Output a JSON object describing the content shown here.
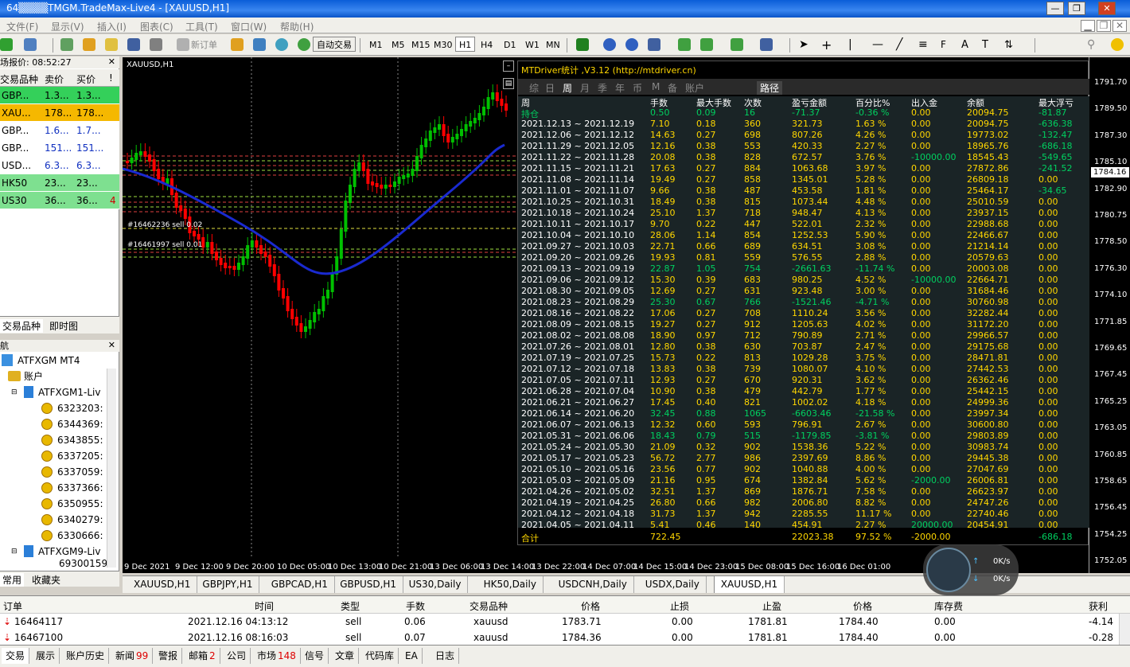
{
  "window": {
    "title": "64▒▒▒▒TMGM.TradeMax-Live4 - [XAUUSD,H1]",
    "buttons": [
      "—",
      "❐",
      "✕"
    ]
  },
  "menu": [
    "文件(F)",
    "显示(V)",
    "插入(I)",
    "图表(C)",
    "工具(T)",
    "窗口(W)",
    "帮助(H)"
  ],
  "toolbar": {
    "new_order": "新订单",
    "auto_trade": "自动交易",
    "timeframes": [
      "M1",
      "M5",
      "M15",
      "M30",
      "H1",
      "H4",
      "D1",
      "W1",
      "MN"
    ],
    "active_timeframe": "H1"
  },
  "market_watch": {
    "title": "场报价: 08:52:27",
    "headers": [
      "交易品种",
      "卖价",
      "买价",
      "!"
    ],
    "rows": [
      {
        "symbol": "GBP...",
        "bid": "1.3...",
        "ask": "1.3...",
        "n": "",
        "color": "#34d05a"
      },
      {
        "symbol": "XAU...",
        "bid": "178...",
        "ask": "178...",
        "n": "",
        "color": "#f5b800"
      },
      {
        "symbol": "GBP...",
        "bid": "1.6...",
        "ask": "1.7...",
        "n": "",
        "color": "#ffffff"
      },
      {
        "symbol": "GBP...",
        "bid": "151...",
        "ask": "151...",
        "n": "",
        "color": "#ffffff"
      },
      {
        "symbol": "USD...",
        "bid": "6.3...",
        "ask": "6.3...",
        "n": "",
        "color": "#ffffff"
      },
      {
        "symbol": "HK50",
        "bid": "23...",
        "ask": "23...",
        "n": "",
        "color": "#7ee090"
      },
      {
        "symbol": "US30",
        "bid": "36...",
        "ask": "36...",
        "n": "4",
        "color": "#7ee090"
      }
    ],
    "tabs": [
      "交易品种",
      "即时图"
    ]
  },
  "navigator": {
    "title": "航",
    "root": "ATFXGM MT4",
    "accounts_label": "账户",
    "server1": "ATFXGM1-Liv",
    "accounts": [
      "6323203:",
      "6344369:",
      "6343855:",
      "6337205:",
      "6337059:",
      "6337366:",
      "6350955:",
      "6340279:",
      "6330666:"
    ],
    "server2": "ATFXGM9-Liv",
    "next_account": "69300159",
    "tabs": [
      "常用",
      "收藏夹"
    ]
  },
  "chart": {
    "symbol_label": "XAUUSD,H1",
    "price_ticks": [
      "1791.70",
      "1789.50",
      "1787.30",
      "1785.10",
      "1782.90",
      "1780.75",
      "1778.50",
      "1776.30",
      "1774.10",
      "1771.85",
      "1769.65",
      "1767.45",
      "1765.25",
      "1763.05",
      "1760.85",
      "1758.65",
      "1756.45",
      "1754.25",
      "1752.05"
    ],
    "current_price": "1784.16",
    "time_ticks": [
      "9 Dec 2021",
      "9 Dec 12:00",
      "9 Dec 20:00",
      "10 Dec 05:00",
      "10 Dec 13:00",
      "10 Dec 21:00",
      "13 Dec 06:00",
      "13 Dec 14:00",
      "13 Dec 22:00",
      "14 Dec 07:00",
      "14 Dec 15:00",
      "14 Dec 23:00",
      "15 Dec 08:00",
      "15 Dec 16:00",
      "16 Dec 01:00"
    ],
    "order_labels": [
      "#16462236 sell 0.02",
      "#16461997 sell 0.01"
    ],
    "colors": {
      "bull": "#00c000",
      "bear": "#ff0000",
      "ma": "#1a2ad0"
    }
  },
  "stats": {
    "title": "MTDriver统计 ,V3.12 (http://mtdriver.cn)",
    "tabs": [
      "综",
      "日",
      "周",
      "月",
      "季",
      "年",
      "币",
      "M",
      "备",
      "账户",
      "路径"
    ],
    "active_tab": "周",
    "headers": [
      "周",
      "手数",
      "最大手数",
      "次数",
      "盈亏金额",
      "百分比%",
      "出入金",
      "余额",
      "最大浮亏"
    ],
    "holding": {
      "label": "持仓",
      "lots": "0.50",
      "max": "0.09",
      "count": "16",
      "pl": "-71.37",
      "pct": "-0.36 %",
      "io": "0.00",
      "bal": "20094.75",
      "dd": "-81.87"
    },
    "rows": [
      {
        "week": "2021.12.13 ~ 2021.12.19",
        "lots": "7.10",
        "max": "0.18",
        "count": "360",
        "pl": "321.73",
        "pct": "1.63 %",
        "io": "0.00",
        "bal": "20094.75",
        "dd": "-636.38"
      },
      {
        "week": "2021.12.06 ~ 2021.12.12",
        "lots": "14.63",
        "max": "0.27",
        "count": "698",
        "pl": "807.26",
        "pct": "4.26 %",
        "io": "0.00",
        "bal": "19773.02",
        "dd": "-132.47"
      },
      {
        "week": "2021.11.29 ~ 2021.12.05",
        "lots": "12.16",
        "max": "0.38",
        "count": "553",
        "pl": "420.33",
        "pct": "2.27 %",
        "io": "0.00",
        "bal": "18965.76",
        "dd": "-686.18"
      },
      {
        "week": "2021.11.22 ~ 2021.11.28",
        "lots": "20.08",
        "max": "0.38",
        "count": "828",
        "pl": "672.57",
        "pct": "3.76 %",
        "io": "-10000.00",
        "bal": "18545.43",
        "dd": "-549.65"
      },
      {
        "week": "2021.11.15 ~ 2021.11.21",
        "lots": "17.63",
        "max": "0.27",
        "count": "884",
        "pl": "1063.68",
        "pct": "3.97 %",
        "io": "0.00",
        "bal": "27872.86",
        "dd": "-241.52"
      },
      {
        "week": "2021.11.08 ~ 2021.11.14",
        "lots": "19.49",
        "max": "0.27",
        "count": "858",
        "pl": "1345.01",
        "pct": "5.28 %",
        "io": "0.00",
        "bal": "26809.18",
        "dd": "0.00"
      },
      {
        "week": "2021.11.01 ~ 2021.11.07",
        "lots": "9.66",
        "max": "0.38",
        "count": "487",
        "pl": "453.58",
        "pct": "1.81 %",
        "io": "0.00",
        "bal": "25464.17",
        "dd": "-34.65"
      },
      {
        "week": "2021.10.25 ~ 2021.10.31",
        "lots": "18.49",
        "max": "0.38",
        "count": "815",
        "pl": "1073.44",
        "pct": "4.48 %",
        "io": "0.00",
        "bal": "25010.59",
        "dd": "0.00"
      },
      {
        "week": "2021.10.18 ~ 2021.10.24",
        "lots": "25.10",
        "max": "1.37",
        "count": "718",
        "pl": "948.47",
        "pct": "4.13 %",
        "io": "0.00",
        "bal": "23937.15",
        "dd": "0.00"
      },
      {
        "week": "2021.10.11 ~ 2021.10.17",
        "lots": "9.70",
        "max": "0.22",
        "count": "447",
        "pl": "522.01",
        "pct": "2.32 %",
        "io": "0.00",
        "bal": "22988.68",
        "dd": "0.00"
      },
      {
        "week": "2021.10.04 ~ 2021.10.10",
        "lots": "28.06",
        "max": "1.14",
        "count": "854",
        "pl": "1252.53",
        "pct": "5.90 %",
        "io": "0.00",
        "bal": "22466.67",
        "dd": "0.00"
      },
      {
        "week": "2021.09.27 ~ 2021.10.03",
        "lots": "22.71",
        "max": "0.66",
        "count": "689",
        "pl": "634.51",
        "pct": "3.08 %",
        "io": "0.00",
        "bal": "21214.14",
        "dd": "0.00"
      },
      {
        "week": "2021.09.20 ~ 2021.09.26",
        "lots": "19.93",
        "max": "0.81",
        "count": "559",
        "pl": "576.55",
        "pct": "2.88 %",
        "io": "0.00",
        "bal": "20579.63",
        "dd": "0.00"
      },
      {
        "week": "2021.09.13 ~ 2021.09.19",
        "lots": "22.87",
        "max": "1.05",
        "count": "754",
        "pl": "-2661.63",
        "pct": "-11.74 %",
        "io": "0.00",
        "bal": "20003.08",
        "dd": "0.00"
      },
      {
        "week": "2021.09.06 ~ 2021.09.12",
        "lots": "15.30",
        "max": "0.39",
        "count": "683",
        "pl": "980.25",
        "pct": "4.52 %",
        "io": "-10000.00",
        "bal": "22664.71",
        "dd": "0.00"
      },
      {
        "week": "2021.08.30 ~ 2021.09.05",
        "lots": "12.69",
        "max": "0.27",
        "count": "631",
        "pl": "923.48",
        "pct": "3.00 %",
        "io": "0.00",
        "bal": "31684.46",
        "dd": "0.00"
      },
      {
        "week": "2021.08.23 ~ 2021.08.29",
        "lots": "25.30",
        "max": "0.67",
        "count": "766",
        "pl": "-1521.46",
        "pct": "-4.71 %",
        "io": "0.00",
        "bal": "30760.98",
        "dd": "0.00"
      },
      {
        "week": "2021.08.16 ~ 2021.08.22",
        "lots": "17.06",
        "max": "0.27",
        "count": "708",
        "pl": "1110.24",
        "pct": "3.56 %",
        "io": "0.00",
        "bal": "32282.44",
        "dd": "0.00"
      },
      {
        "week": "2021.08.09 ~ 2021.08.15",
        "lots": "19.27",
        "max": "0.27",
        "count": "912",
        "pl": "1205.63",
        "pct": "4.02 %",
        "io": "0.00",
        "bal": "31172.20",
        "dd": "0.00"
      },
      {
        "week": "2021.08.02 ~ 2021.08.08",
        "lots": "18.90",
        "max": "0.97",
        "count": "712",
        "pl": "790.89",
        "pct": "2.71 %",
        "io": "0.00",
        "bal": "29966.57",
        "dd": "0.00"
      },
      {
        "week": "2021.07.26 ~ 2021.08.01",
        "lots": "12.80",
        "max": "0.38",
        "count": "630",
        "pl": "703.87",
        "pct": "2.47 %",
        "io": "0.00",
        "bal": "29175.68",
        "dd": "0.00"
      },
      {
        "week": "2021.07.19 ~ 2021.07.25",
        "lots": "15.73",
        "max": "0.22",
        "count": "813",
        "pl": "1029.28",
        "pct": "3.75 %",
        "io": "0.00",
        "bal": "28471.81",
        "dd": "0.00"
      },
      {
        "week": "2021.07.12 ~ 2021.07.18",
        "lots": "13.83",
        "max": "0.38",
        "count": "739",
        "pl": "1080.07",
        "pct": "4.10 %",
        "io": "0.00",
        "bal": "27442.53",
        "dd": "0.00"
      },
      {
        "week": "2021.07.05 ~ 2021.07.11",
        "lots": "12.93",
        "max": "0.27",
        "count": "670",
        "pl": "920.31",
        "pct": "3.62 %",
        "io": "0.00",
        "bal": "26362.46",
        "dd": "0.00"
      },
      {
        "week": "2021.06.28 ~ 2021.07.04",
        "lots": "10.90",
        "max": "0.38",
        "count": "479",
        "pl": "442.79",
        "pct": "1.77 %",
        "io": "0.00",
        "bal": "25442.15",
        "dd": "0.00"
      },
      {
        "week": "2021.06.21 ~ 2021.06.27",
        "lots": "17.45",
        "max": "0.40",
        "count": "821",
        "pl": "1002.02",
        "pct": "4.18 %",
        "io": "0.00",
        "bal": "24999.36",
        "dd": "0.00"
      },
      {
        "week": "2021.06.14 ~ 2021.06.20",
        "lots": "32.45",
        "max": "0.88",
        "count": "1065",
        "pl": "-6603.46",
        "pct": "-21.58 %",
        "io": "0.00",
        "bal": "23997.34",
        "dd": "0.00"
      },
      {
        "week": "2021.06.07 ~ 2021.06.13",
        "lots": "12.32",
        "max": "0.60",
        "count": "593",
        "pl": "796.91",
        "pct": "2.67 %",
        "io": "0.00",
        "bal": "30600.80",
        "dd": "0.00"
      },
      {
        "week": "2021.05.31 ~ 2021.06.06",
        "lots": "18.43",
        "max": "0.79",
        "count": "515",
        "pl": "-1179.85",
        "pct": "-3.81 %",
        "io": "0.00",
        "bal": "29803.89",
        "dd": "0.00"
      },
      {
        "week": "2021.05.24 ~ 2021.05.30",
        "lots": "21.09",
        "max": "0.32",
        "count": "902",
        "pl": "1538.36",
        "pct": "5.22 %",
        "io": "0.00",
        "bal": "30983.74",
        "dd": "0.00"
      },
      {
        "week": "2021.05.17 ~ 2021.05.23",
        "lots": "56.72",
        "max": "2.77",
        "count": "986",
        "pl": "2397.69",
        "pct": "8.86 %",
        "io": "0.00",
        "bal": "29445.38",
        "dd": "0.00"
      },
      {
        "week": "2021.05.10 ~ 2021.05.16",
        "lots": "23.56",
        "max": "0.77",
        "count": "902",
        "pl": "1040.88",
        "pct": "4.00 %",
        "io": "0.00",
        "bal": "27047.69",
        "dd": "0.00"
      },
      {
        "week": "2021.05.03 ~ 2021.05.09",
        "lots": "21.16",
        "max": "0.95",
        "count": "674",
        "pl": "1382.84",
        "pct": "5.62 %",
        "io": "-2000.00",
        "bal": "26006.81",
        "dd": "0.00"
      },
      {
        "week": "2021.04.26 ~ 2021.05.02",
        "lots": "32.51",
        "max": "1.37",
        "count": "869",
        "pl": "1876.71",
        "pct": "7.58 %",
        "io": "0.00",
        "bal": "26623.97",
        "dd": "0.00"
      },
      {
        "week": "2021.04.19 ~ 2021.04.25",
        "lots": "26.80",
        "max": "0.66",
        "count": "982",
        "pl": "2006.80",
        "pct": "8.82 %",
        "io": "0.00",
        "bal": "24747.26",
        "dd": "0.00"
      },
      {
        "week": "2021.04.12 ~ 2021.04.18",
        "lots": "31.73",
        "max": "1.37",
        "count": "942",
        "pl": "2285.55",
        "pct": "11.17 %",
        "io": "0.00",
        "bal": "22740.46",
        "dd": "0.00"
      },
      {
        "week": "2021.04.05 ~ 2021.04.11",
        "lots": "5.41",
        "max": "0.46",
        "count": "140",
        "pl": "454.91",
        "pct": "2.27 %",
        "io": "20000.00",
        "bal": "20454.91",
        "dd": "0.00"
      }
    ],
    "total": {
      "label": "合计",
      "lots": "722.45",
      "pl": "22023.38",
      "pct": "97.52 %",
      "io": "-2000.00",
      "dd": "-686.18"
    }
  },
  "symbol_tabs": [
    "XAUUSD,H1",
    "GBPJPY,H1",
    "GBPCAD,H1",
    "GBPUSD,H1",
    "US30,Daily",
    "HK50,Daily",
    "USDCNH,Daily",
    "USDX,Daily",
    "XAUUSD,H1"
  ],
  "active_symbol_tab": 8,
  "widget": {
    "up": "0K/s",
    "down": "0K/s"
  },
  "terminal": {
    "headers": [
      "订单",
      "时间",
      "类型",
      "手数",
      "交易品种",
      "价格",
      "止损",
      "止盈",
      "价格",
      "库存费",
      "获利"
    ],
    "rows": [
      {
        "order": "16464117",
        "time": "2021.12.16 04:13:12",
        "type": "sell",
        "lots": "0.06",
        "symbol": "xauusd",
        "price": "1783.71",
        "sl": "0.00",
        "tp": "1781.81",
        "cur": "1784.40",
        "swap": "0.00",
        "profit": "-4.14"
      },
      {
        "order": "16467100",
        "time": "2021.12.16 08:16:03",
        "type": "sell",
        "lots": "0.07",
        "symbol": "xauusd",
        "price": "1784.36",
        "sl": "0.00",
        "tp": "1781.81",
        "cur": "1784.40",
        "swap": "0.00",
        "profit": "-0.28"
      }
    ],
    "tabs": [
      {
        "label": "交易",
        "badge": ""
      },
      {
        "label": "展示",
        "badge": ""
      },
      {
        "label": "账户历史",
        "badge": ""
      },
      {
        "label": "新闻",
        "badge": "99"
      },
      {
        "label": "警报",
        "badge": ""
      },
      {
        "label": "邮箱",
        "badge": "2"
      },
      {
        "label": "公司",
        "badge": ""
      },
      {
        "label": "市场",
        "badge": "148"
      },
      {
        "label": "信号",
        "badge": ""
      },
      {
        "label": "文章",
        "badge": ""
      },
      {
        "label": "代码库",
        "badge": ""
      },
      {
        "label": "EA",
        "badge": ""
      },
      {
        "label": "日志",
        "badge": ""
      }
    ]
  }
}
